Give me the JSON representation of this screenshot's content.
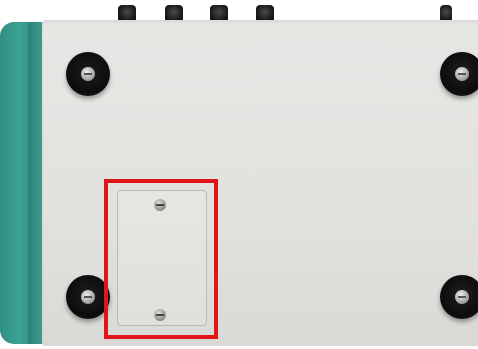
{
  "image": {
    "subject": "device-bottom-view",
    "colors": {
      "panel": "#e4e5e1",
      "side_trim": "#3aa295",
      "feet": "#111111",
      "highlight": "#e1141a"
    },
    "knob_count": 4,
    "feet_count": 4
  }
}
